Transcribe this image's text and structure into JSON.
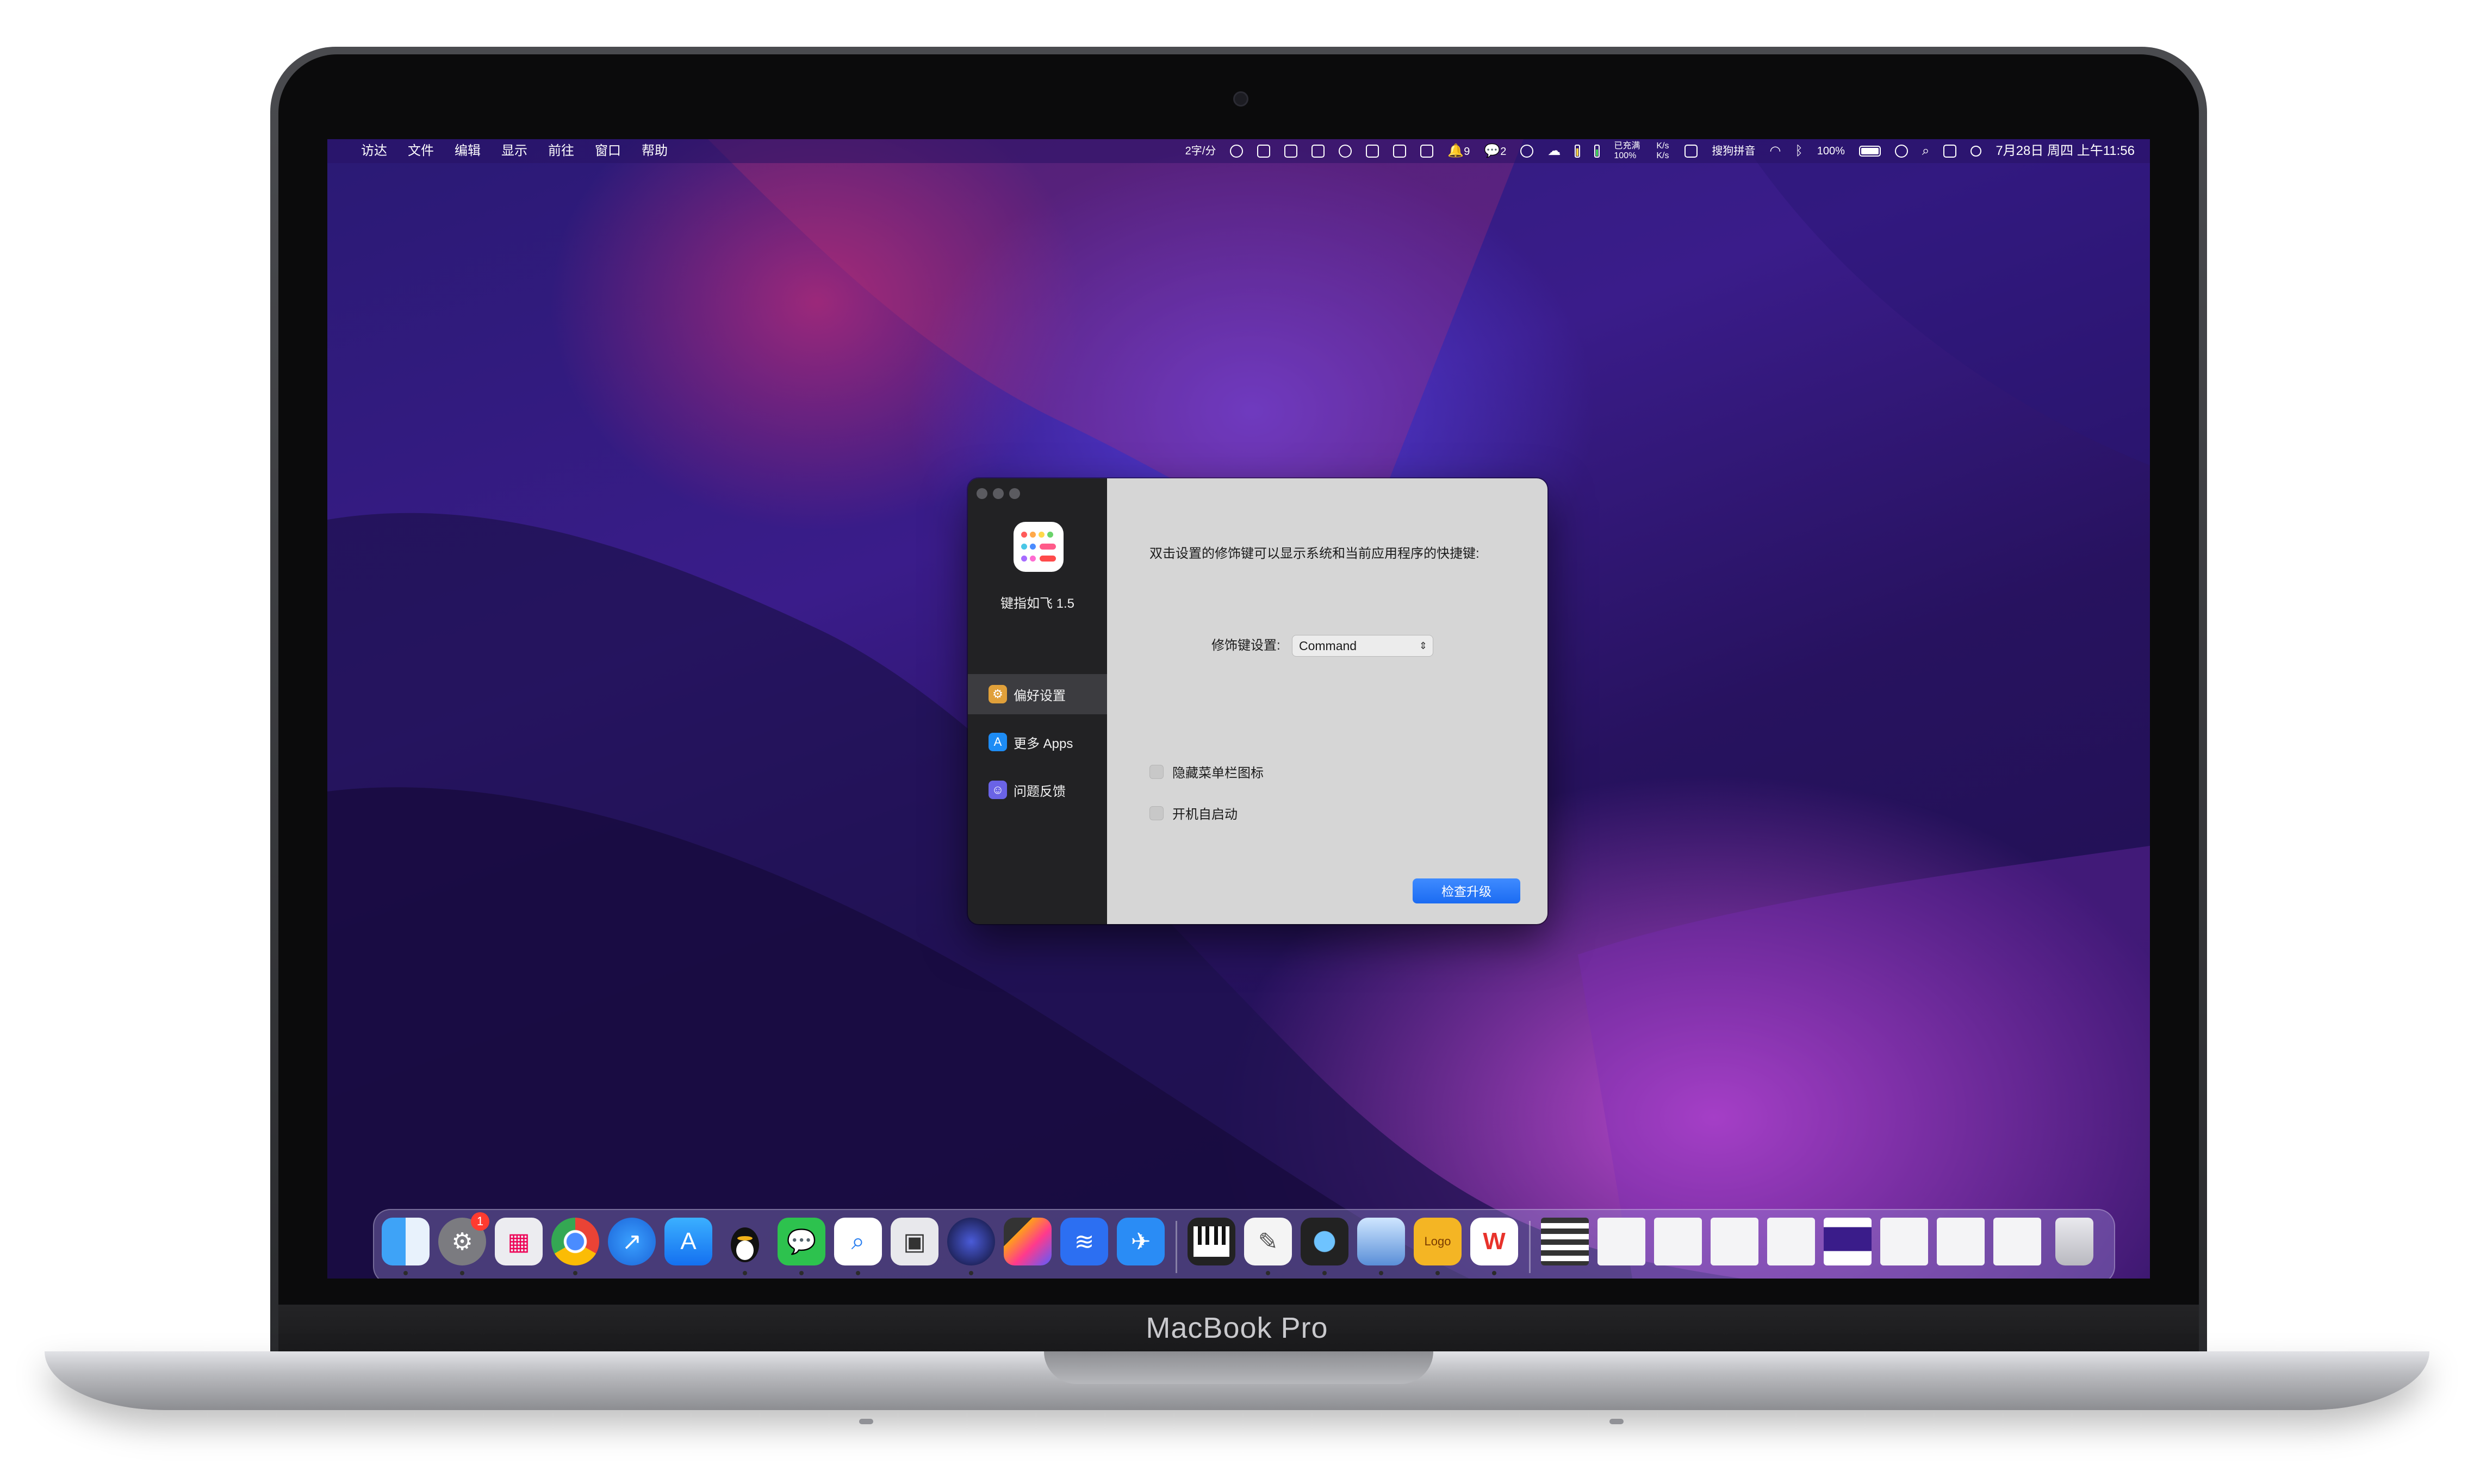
{
  "device": {
    "model_label": "MacBook Pro"
  },
  "menubar": {
    "apple_glyph": "",
    "app_menus": [
      "访达",
      "文件",
      "编辑",
      "显示",
      "前往",
      "窗口",
      "帮助"
    ],
    "status_typing": "2字/分",
    "status_bell_count": "9",
    "status_wechat_count": "2",
    "status_cpu": "已充满 100%",
    "status_net": "K/s K/s",
    "status_ime": "搜狗拼音",
    "status_battery_pct": "100%",
    "clock": "7月28日 周四 上午11:56"
  },
  "window": {
    "sidebar": {
      "app_name": "键指如飞 1.5",
      "nav": [
        {
          "label": "偏好设置",
          "icon": "gear-icon",
          "active": true
        },
        {
          "label": "更多 Apps",
          "icon": "app-store-icon",
          "active": false
        },
        {
          "label": "问题反馈",
          "icon": "feedback-icon",
          "active": false
        }
      ]
    },
    "content": {
      "description": "双击设置的修饰键可以显示系统和当前应用程序的快捷键:",
      "modifier_label": "修饰键设置:",
      "modifier_value": "Command",
      "options": [
        {
          "label": "隐藏菜单栏图标",
          "checked": false
        },
        {
          "label": "开机自启动",
          "checked": false
        }
      ],
      "upgrade_button": "检查升级"
    }
  },
  "dock": {
    "settings_badge": "1",
    "logo_app_text": "Logo",
    "apps": [
      "finder-icon",
      "system-preferences-icon",
      "launchpad-icon",
      "chrome-icon",
      "safari-icon",
      "app-store-icon",
      "qq-icon",
      "wechat-icon",
      "quicklook-icon",
      "screenshot-icon",
      "cinema4d-icon",
      "final-cut-icon",
      "lanhu-icon",
      "testflight-icon",
      "piano-icon",
      "textedit-icon",
      "quicktime-icon",
      "preview-icon",
      "logo-maker-icon",
      "wps-icon"
    ]
  }
}
